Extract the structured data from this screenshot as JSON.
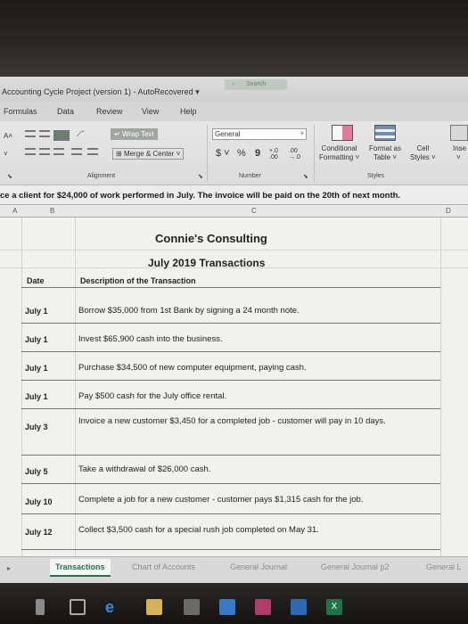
{
  "window": {
    "title": "Accounting Cycle Project (version 1)  -  AutoRecovered",
    "title_caret": "▾",
    "search_placeholder": "Search"
  },
  "menu": [
    "Formulas",
    "Data",
    "Review",
    "View",
    "Help"
  ],
  "ribbon": {
    "font_size_arrow": "A˄",
    "wrap_text": "Wrap Text",
    "merge_center": "Merge & Center",
    "number_format": "General",
    "currency": "$",
    "percent": "%",
    "comma": "9",
    "conditional_formatting": [
      "Conditional",
      "Formatting"
    ],
    "format_as_table": [
      "Format as",
      "Table"
    ],
    "cell_styles": [
      "Cell",
      "Styles"
    ],
    "insert": "Inse",
    "alignment_label": "Alignment",
    "number_label": "Number",
    "styles_label": "Styles"
  },
  "formula_bar": {
    "text": "ce a client for $24,000 of work performed in July.  The invoice will be paid on the 20th of next month."
  },
  "columns": [
    "A",
    "B",
    "C",
    "D"
  ],
  "sheet": {
    "company": "Connie's Consulting",
    "subtitle": "July 2019 Transactions",
    "header_date": "Date",
    "header_desc": "Description of the Transaction",
    "rows": [
      {
        "date": "July 1",
        "desc": "Borrow $35,000 from 1st Bank by signing a 24 month note."
      },
      {
        "date": "July 1",
        "desc": "Invest $65,900 cash into the business."
      },
      {
        "date": "July 1",
        "desc": "Purchase $34,500 of new computer equipment, paying cash."
      },
      {
        "date": "July 1",
        "desc": "Pay $500 cash for the July office rental."
      },
      {
        "date": "July 3",
        "desc": "Invoice a new customer $3,450 for a completed job - customer will pay in 10 days."
      },
      {
        "date": "July 5",
        "desc": "Take a withdrawal of $26,000 cash."
      },
      {
        "date": "July 10",
        "desc": "Complete a job for a new customer - customer pays $1,315 cash for the job."
      },
      {
        "date": "July 12",
        "desc": "Collect $3,500 cash for a special rush job completed on May 31."
      }
    ]
  },
  "tabs": [
    "Transactions",
    "Chart of Accounts",
    "General Journal",
    "General Journal p2",
    "General L"
  ],
  "colors": {
    "excel_green": "#217346",
    "sheet_bg": "#f1f1ef"
  }
}
